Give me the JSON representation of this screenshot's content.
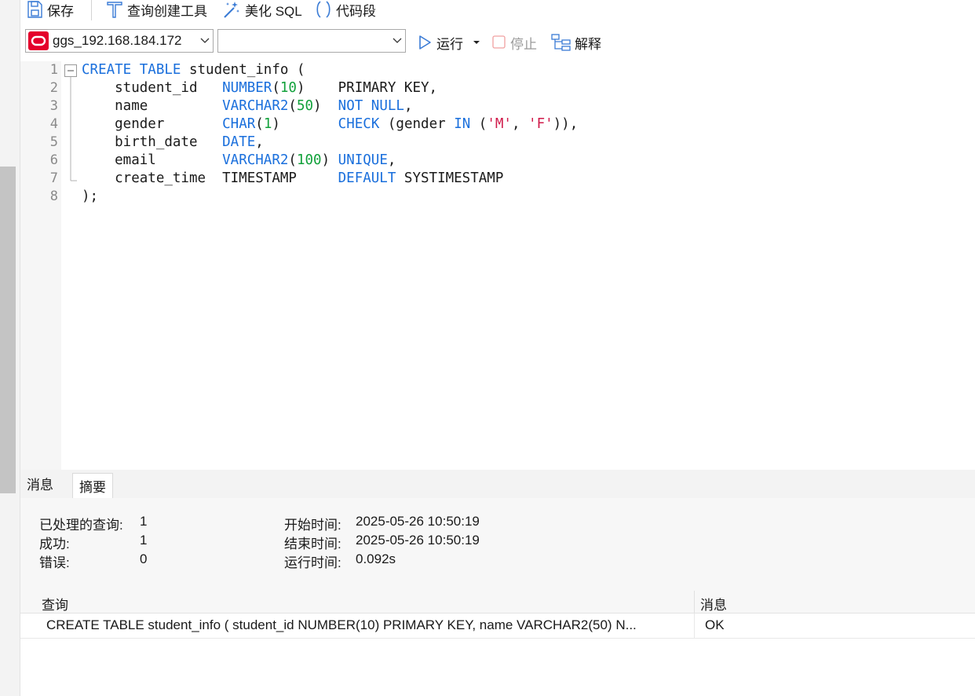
{
  "toolbar": {
    "save_label": "保存",
    "query_builder_label": "查询创建工具",
    "beautify_label": "美化 SQL",
    "snippet_label": "代码段"
  },
  "connection_bar": {
    "connection_value": "ggs_192.168.184.172",
    "database_value": "",
    "run_label": "运行",
    "stop_label": "停止",
    "explain_label": "解释"
  },
  "editor": {
    "line_numbers": [
      "1",
      "2",
      "3",
      "4",
      "5",
      "6",
      "7",
      "8"
    ]
  },
  "result": {
    "tabs": [
      {
        "label": "消息"
      },
      {
        "label": "摘要"
      }
    ],
    "summary": {
      "processed_label": "已处理的查询:",
      "processed_value": "1",
      "success_label": "成功:",
      "success_value": "1",
      "error_label": "错误:",
      "error_value": "0",
      "start_label": "开始时间:",
      "start_value": "2025-05-26 10:50:19",
      "end_label": "结束时间:",
      "end_value": "2025-05-26 10:50:19",
      "elapsed_label": "运行时间:",
      "elapsed_value": "0.092s"
    },
    "grid": {
      "columns": [
        "查询",
        "消息"
      ],
      "rows": [
        {
          "query": "CREATE TABLE student_info ( student_id NUMBER(10) PRIMARY KEY, name VARCHAR2(50) N...",
          "message": "OK"
        }
      ]
    }
  },
  "colors": {
    "keyword": "#1a6fdc",
    "number": "#12a13b",
    "string": "#d01a4a",
    "oracle_red": "#e4002b"
  }
}
